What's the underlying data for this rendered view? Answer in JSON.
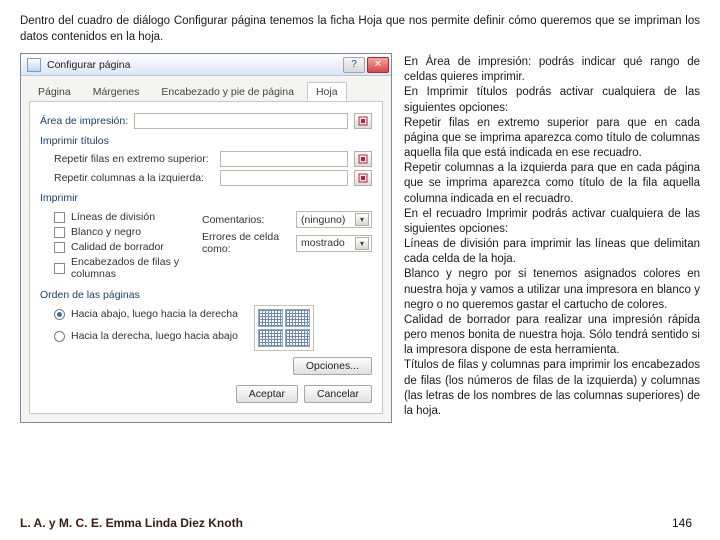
{
  "intro": "Dentro del cuadro de diálogo Configurar página tenemos la ficha Hoja que nos permite definir cómo queremos que se impriman los datos contenidos en la hoja.",
  "dialog": {
    "title": "Configurar página",
    "tabs": {
      "t0": "Página",
      "t1": "Márgenes",
      "t2": "Encabezado y pie de página",
      "t3": "Hoja"
    },
    "area": {
      "label": "Área de impresión:",
      "value": ""
    },
    "titles": {
      "group": "Imprimir títulos",
      "top_label": "Repetir filas en extremo superior:",
      "top_value": "",
      "left_label": "Repetir columnas a la izquierda:",
      "left_value": ""
    },
    "print": {
      "group": "Imprimir",
      "gridlines": "Líneas de división",
      "bw": "Blanco y negro",
      "draft": "Calidad de borrador",
      "headings": "Encabezados de filas y columnas",
      "comments_label": "Comentarios:",
      "comments_value": "(ninguno)",
      "errors_label": "Errores de celda como:",
      "errors_value": "mostrado"
    },
    "order": {
      "group": "Orden de las páginas",
      "opt1": "Hacia abajo, luego hacia la derecha",
      "opt2": "Hacia la derecha, luego hacia abajo"
    },
    "buttons": {
      "options": "Opciones...",
      "ok": "Aceptar",
      "cancel": "Cancelar"
    }
  },
  "explain": {
    "p1": "En  Área de impresión: podrás indicar qué rango de celdas quieres imprimir.",
    "p2": "En Imprimir títulos podrás activar cualquiera de las siguientes opciones:",
    "p3": "Repetir filas en extremo superior para que en cada página que se imprima aparezca como título de columnas aquella fila que está indicada en ese recuadro.",
    "p4": "Repetir columnas a la izquierda para que en cada página que se imprima aparezca como título de la fila aquella columna indicada en el recuadro.",
    "p5": "En el recuadro Imprimir podrás activar cualquiera de las siguientes opciones:",
    "p6": "Líneas de división para imprimir las líneas que delimitan cada celda de la hoja.",
    "p7": "Blanco y negro por si tenemos asignados colores en nuestra hoja y vamos a utilizar una impresora en blanco y negro o no queremos gastar el cartucho de colores.",
    "p8": "Calidad de borrador para realizar una impresión rápida pero menos bonita de nuestra hoja. Sólo tendrá sentido si la impresora dispone de esta herramienta.",
    "p9": "Títulos de filas y columnas para imprimir los encabezados de filas (los números de filas de la izquierda) y columnas (las letras de los nombres de las columnas superiores) de la hoja."
  },
  "footer": {
    "author": "L. A. y M. C. E. Emma Linda Diez Knoth",
    "page": "146"
  }
}
